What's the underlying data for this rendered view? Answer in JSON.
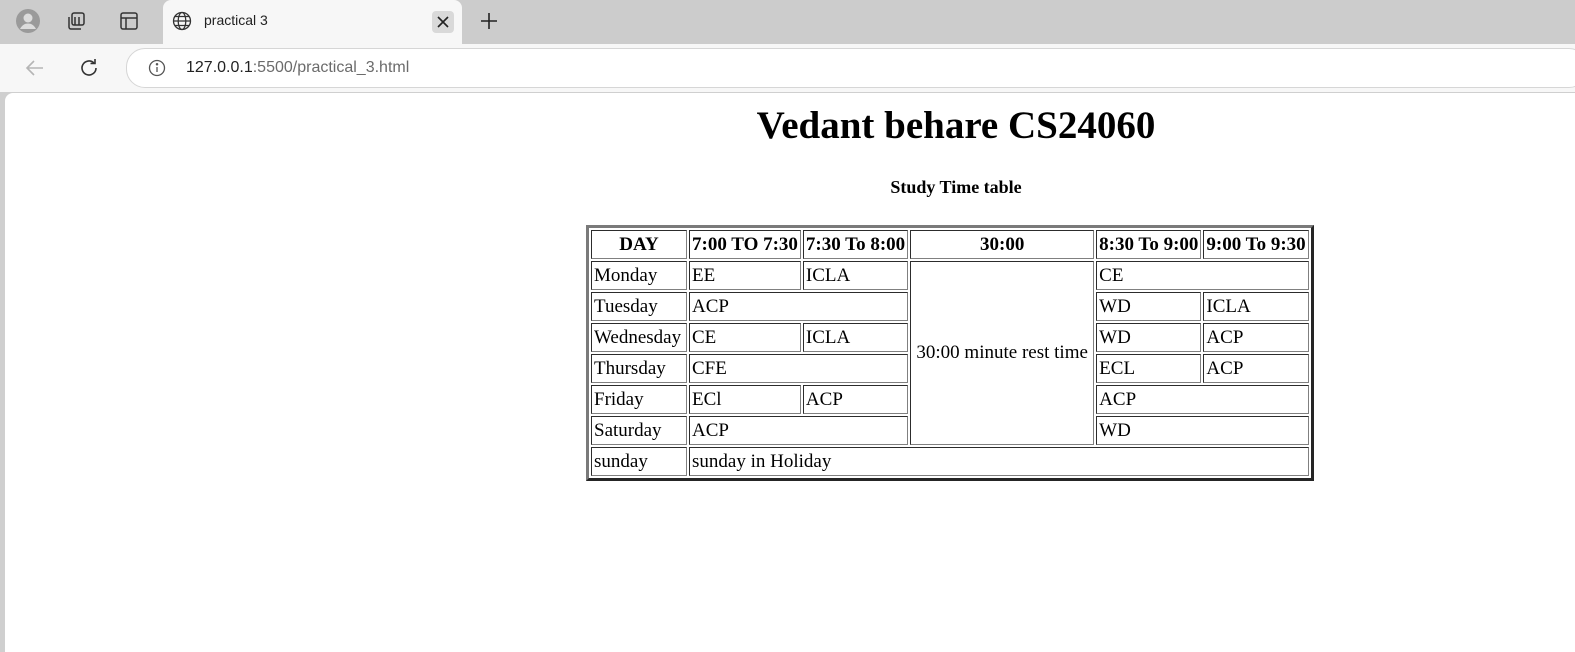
{
  "browser": {
    "tab": {
      "title": "practical 3"
    },
    "address": {
      "host": "127.0.0.1",
      "rest": ":5500/practical_3.html"
    }
  },
  "page": {
    "heading": "Vedant behare CS24060",
    "caption": "Study Time table"
  },
  "table": {
    "headers": [
      "DAY",
      "7:00 TO 7:30",
      "7:30 To 8:00",
      "30:00",
      "8:30 To 9:00",
      "9:00 To 9:30"
    ],
    "rest_label": "30:00 minute rest time",
    "monday": {
      "day": "Monday",
      "s1": "EE",
      "s2": "ICLA",
      "s4": "CE"
    },
    "tuesday": {
      "day": "Tuesday",
      "s1": "ACP",
      "s4": "WD",
      "s5": "ICLA"
    },
    "wednesday": {
      "day": "Wednesday",
      "s1": "CE",
      "s2": "ICLA",
      "s4": "WD",
      "s5": "ACP"
    },
    "thursday": {
      "day": "Thursday",
      "s1": "CFE",
      "s4": "ECL",
      "s5": "ACP"
    },
    "friday": {
      "day": "Friday",
      "s1": "ECl",
      "s2": "ACP",
      "s4": "ACP"
    },
    "saturday": {
      "day": "Saturday",
      "s1": "ACP",
      "s4": "WD"
    },
    "sunday": {
      "day": "sunday",
      "note": "sunday in Holiday"
    }
  }
}
